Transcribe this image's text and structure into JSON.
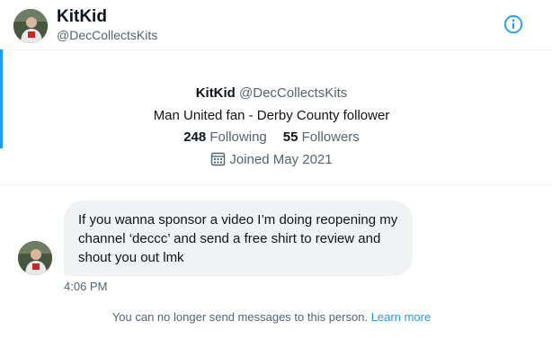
{
  "header": {
    "name": "KitKid",
    "handle": "@DecCollectsKits",
    "avatar_icon": "profile-avatar",
    "info_icon": "info-circle-icon",
    "accent_color": "#1d9bf0"
  },
  "profile": {
    "name": "KitKid",
    "handle": "@DecCollectsKits",
    "bio": "Man United fan - Derby County follower",
    "following_count": "248",
    "following_label": "Following",
    "followers_count": "55",
    "followers_label": "Followers",
    "joined_icon": "calendar-icon",
    "joined": "Joined May 2021"
  },
  "conversation": {
    "messages": [
      {
        "text": "If you wanna sponsor a video I’m doing reopening my channel ‘deccc’ and send a free shirt to review and shout you out lmk",
        "time": "4:06 PM"
      }
    ],
    "notice": "You can no longer send messages to this person.",
    "learn_more": "Learn more"
  }
}
